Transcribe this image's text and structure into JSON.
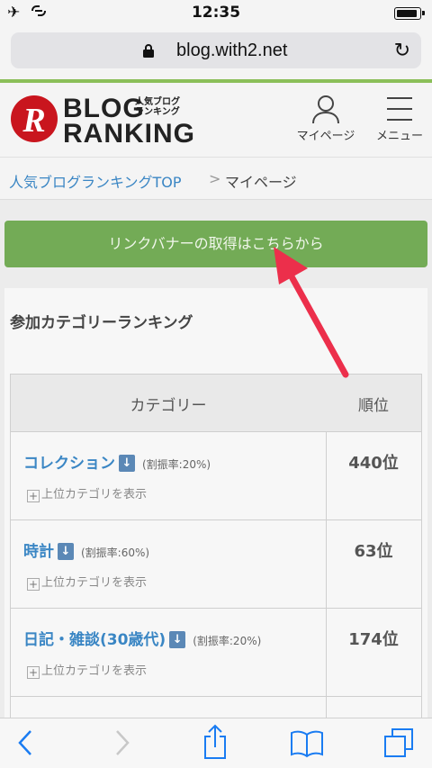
{
  "status_bar": {
    "time": "12:35",
    "battery_level": 0.9
  },
  "browser": {
    "url": "blog.with2.net"
  },
  "header": {
    "logo_letter": "R",
    "logo_top": "BLOG",
    "logo_bottom": "RANKING",
    "logo_sub_line1": "人気ブログ",
    "logo_sub_line2": "ランキング",
    "mypage_label": "マイページ",
    "menu_label": "メニュー"
  },
  "breadcrumb": {
    "home": "人気ブログランキングTOP",
    "separator": ">",
    "current": "マイページ"
  },
  "banner_button": "リンクバナーの取得はこちらから",
  "ranking": {
    "title": "参加カテゴリーランキング",
    "col_category": "カテゴリー",
    "col_rank": "順位",
    "rows": [
      {
        "category": "コレクション",
        "arrow": "↓",
        "ratio": "(割振率:20%)",
        "parent": "上位カテゴリを表示",
        "rank": "440位"
      },
      {
        "category": "時計",
        "arrow": "↓",
        "ratio": "(割振率:60%)",
        "parent": "上位カテゴリを表示",
        "rank": "63位"
      },
      {
        "category": "日記・雑談(30歳代)",
        "arrow": "↓",
        "ratio": "(割振率:20%)",
        "parent": "上位カテゴリを表示",
        "rank": "174位"
      }
    ]
  },
  "colors": {
    "green": "#73ab56",
    "link_blue": "#3a86c4",
    "annotation_red": "#ec2f4b"
  }
}
